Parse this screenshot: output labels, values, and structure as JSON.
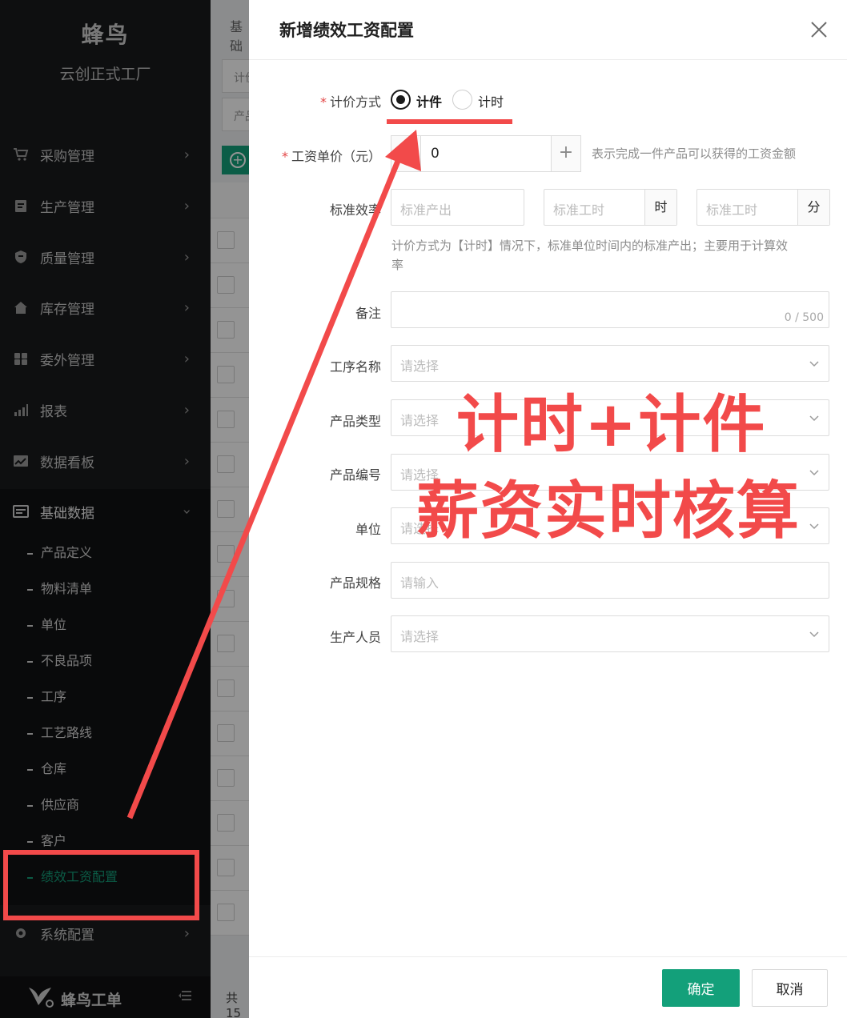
{
  "sidebar": {
    "brand_title": "蜂鸟",
    "brand_subtitle": "云创正式工厂",
    "menu": [
      {
        "label": "采购管理",
        "icon": "cart-icon"
      },
      {
        "label": "生产管理",
        "icon": "clipboard-icon"
      },
      {
        "label": "质量管理",
        "icon": "shield-icon"
      },
      {
        "label": "库存管理",
        "icon": "home-icon"
      },
      {
        "label": "委外管理",
        "icon": "puzzle-icon"
      },
      {
        "label": "报表",
        "icon": "bar-chart-icon"
      },
      {
        "label": "数据看板",
        "icon": "line-chart-icon"
      },
      {
        "label": "基础数据",
        "icon": "database-icon"
      }
    ],
    "submenu": [
      "产品定义",
      "物料清单",
      "单位",
      "不良品项",
      "工序",
      "工艺路线",
      "仓库",
      "供应商",
      "客户",
      "绩效工资配置"
    ],
    "system_config": "系统配置",
    "footer_logo": "蜂鸟工单"
  },
  "background": {
    "breadcrumb_fragment": "基础",
    "filter_fragment_1": "计价",
    "filter_fragment_2": "产品",
    "pagination_fragment": "共15"
  },
  "drawer": {
    "title": "新增绩效工资配置",
    "pricing_method": {
      "label": "计价方式",
      "options": [
        "计件",
        "计时"
      ],
      "selected": "计件"
    },
    "unit_wage": {
      "label": "工资单价（元）",
      "value": "0",
      "hint": "表示完成一件产品可以获得的工资金额",
      "plus": "+"
    },
    "standard_efficiency": {
      "label": "标准效率",
      "output_placeholder": "标准产出",
      "hours_placeholder": "标准工时",
      "hours_unit": "时",
      "minutes_placeholder": "标准工时",
      "minutes_unit": "分",
      "hint_line1": "计价方式为【计时】情况下，标准单位时间内的标准产出；主要用于计算效",
      "hint_line2": "率"
    },
    "remark": {
      "label": "备注",
      "counter": "0 / 500"
    },
    "process_name": {
      "label": "工序名称",
      "placeholder": "请选择"
    },
    "product_type": {
      "label": "产品类型",
      "placeholder": "请选择"
    },
    "product_code": {
      "label": "产品编号",
      "placeholder": "请选择"
    },
    "unit": {
      "label": "单位",
      "placeholder": "请选择"
    },
    "product_spec": {
      "label": "产品规格",
      "placeholder": "请输入"
    },
    "producer": {
      "label": "生产人员",
      "placeholder": "请选择"
    },
    "ok": "确定",
    "cancel": "取消"
  },
  "annotation": {
    "line1": "计时+计件",
    "line2": "薪资实时核算",
    "color": "#f24a4a"
  },
  "colors": {
    "accent": "#13a07a",
    "sidebar_bg": "#191a1c"
  }
}
